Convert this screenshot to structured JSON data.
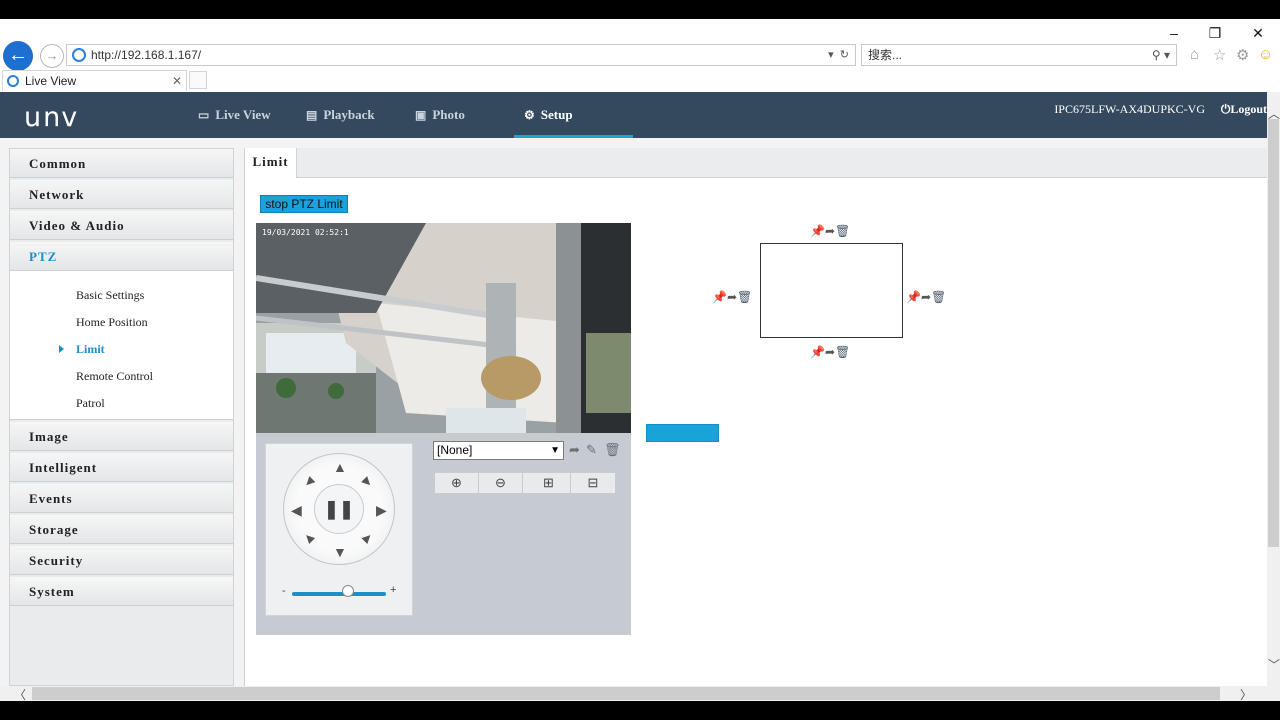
{
  "browser": {
    "url": "http://192.168.1.167/",
    "search_placeholder": "搜索...",
    "tab_title": "Live View",
    "win_min": "–",
    "win_restore": "❐",
    "win_close": "✕"
  },
  "app": {
    "logo": "UNV",
    "nav": [
      {
        "label": "Live View",
        "icon": "monitor-icon"
      },
      {
        "label": "Playback",
        "icon": "film-icon"
      },
      {
        "label": "Photo",
        "icon": "photo-icon"
      },
      {
        "label": "Setup",
        "icon": "gear-icon"
      }
    ],
    "device_name": "IPC675LFW-AX4DUPKC-VG",
    "logout": "Logout"
  },
  "sidebar": {
    "items_top": [
      "Common",
      "Network",
      "Video & Audio",
      "PTZ"
    ],
    "ptz_sub": [
      "Basic Settings",
      "Home Position",
      "Limit",
      "Remote Control",
      "Patrol"
    ],
    "active_sub": "Limit",
    "items_bottom": [
      "Image",
      "Intelligent",
      "Events",
      "Storage",
      "Security",
      "System"
    ]
  },
  "content": {
    "tab_label": "Limit",
    "stop_button": "stop PTZ Limit",
    "video_timestamp": "19/03/2021 02:52:1",
    "preset_value": "[None]",
    "slider_minus": "-",
    "slider_plus": "+",
    "slider_value": 0.6
  },
  "colors": {
    "header_bg": "#34495e",
    "accent": "#1aa3d8",
    "active_text": "#1a8fc9"
  }
}
